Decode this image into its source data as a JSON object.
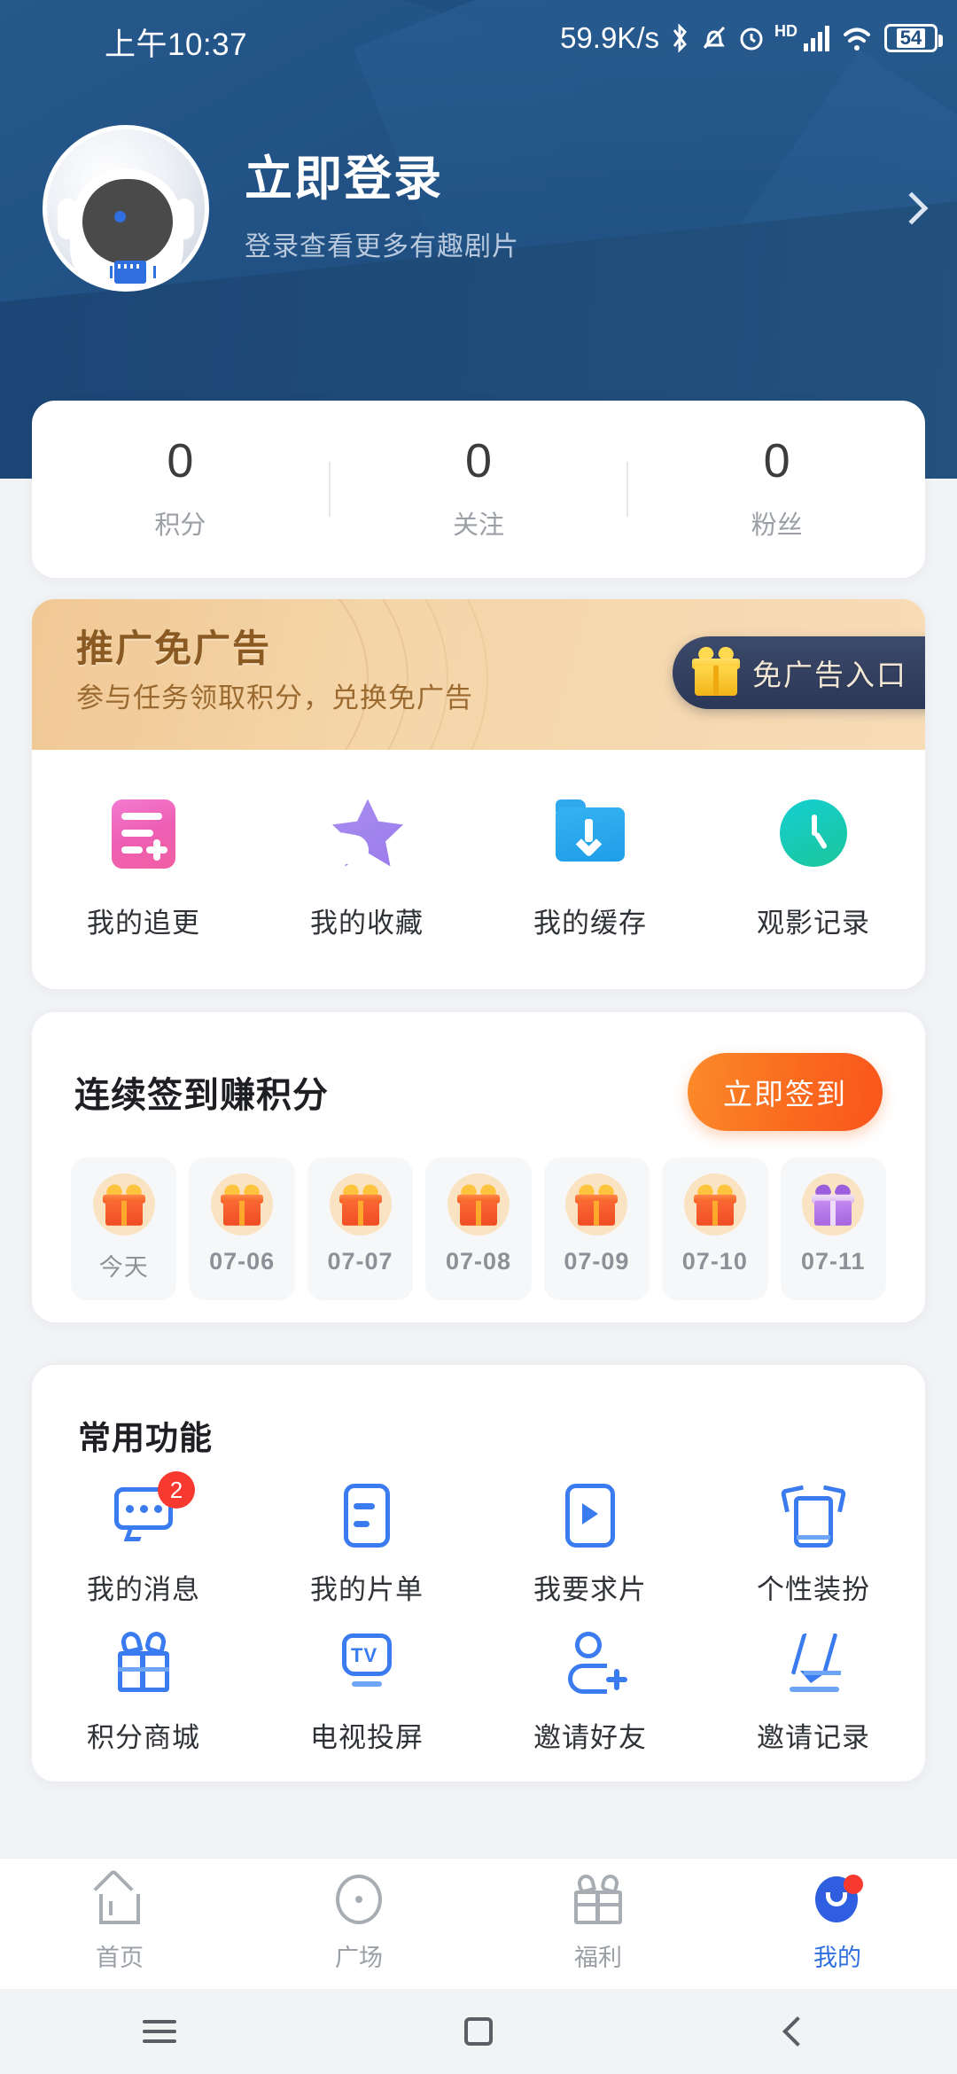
{
  "status_bar": {
    "time": "上午10:37",
    "network_speed": "59.9K/s",
    "hd_label": "HD",
    "battery": "54",
    "icons": [
      "bluetooth-icon",
      "mute-vibrate-icon",
      "alarm-icon",
      "hd-icon",
      "signal-icon",
      "wifi-icon",
      "battery-icon"
    ]
  },
  "profile": {
    "title": "立即登录",
    "subtitle": "登录查看更多有趣剧片",
    "avatar_icon": "robot-avatar",
    "arrow_icon": "chevron-right-icon"
  },
  "stats": [
    {
      "value": "0",
      "label": "积分"
    },
    {
      "value": "0",
      "label": "关注"
    },
    {
      "value": "0",
      "label": "粉丝"
    }
  ],
  "promo": {
    "title": "推广免广告",
    "subtitle": "参与任务领取积分，兑换免广告",
    "button_label": "免广告入口",
    "button_icon": "gift-icon"
  },
  "quick_actions": [
    {
      "label": "我的追更",
      "icon": "list-add-icon"
    },
    {
      "label": "我的收藏",
      "icon": "star-icon"
    },
    {
      "label": "我的缓存",
      "icon": "folder-download-icon"
    },
    {
      "label": "观影记录",
      "icon": "clock-icon"
    }
  ],
  "sign_in": {
    "title": "连续签到赚积分",
    "button_label": "立即签到",
    "days": [
      {
        "label": "今天",
        "icon": "gift-orange-icon",
        "today": true
      },
      {
        "label": "07-06",
        "icon": "gift-orange-icon",
        "today": false
      },
      {
        "label": "07-07",
        "icon": "gift-orange-icon",
        "today": false
      },
      {
        "label": "07-08",
        "icon": "gift-orange-icon",
        "today": false
      },
      {
        "label": "07-09",
        "icon": "gift-orange-icon",
        "today": false
      },
      {
        "label": "07-10",
        "icon": "gift-orange-icon",
        "today": false
      },
      {
        "label": "07-11",
        "icon": "gift-purple-icon",
        "today": false
      }
    ]
  },
  "common_functions": {
    "title": "常用功能",
    "items": [
      {
        "label": "我的消息",
        "icon": "message-icon",
        "badge": "2"
      },
      {
        "label": "我的片单",
        "icon": "playlist-icon",
        "badge": ""
      },
      {
        "label": "我要求片",
        "icon": "request-video-icon",
        "badge": ""
      },
      {
        "label": "个性装扮",
        "icon": "outfit-icon",
        "badge": ""
      },
      {
        "label": "积分商城",
        "icon": "gift-shop-icon",
        "badge": ""
      },
      {
        "label": "电视投屏",
        "icon": "tv-cast-icon",
        "badge": ""
      },
      {
        "label": "邀请好友",
        "icon": "add-friend-icon",
        "badge": ""
      },
      {
        "label": "邀请记录",
        "icon": "edit-record-icon",
        "badge": ""
      }
    ]
  },
  "bottom_nav": [
    {
      "label": "首页",
      "icon": "home-icon",
      "active": false
    },
    {
      "label": "广场",
      "icon": "discover-icon",
      "active": false
    },
    {
      "label": "福利",
      "icon": "gift-nav-icon",
      "active": false
    },
    {
      "label": "我的",
      "icon": "profile-icon",
      "active": true
    }
  ],
  "system_nav": {
    "recents": "menu-icon",
    "home": "square-icon",
    "back": "back-icon"
  },
  "colors": {
    "header_blue": "#1f4e80",
    "accent_blue": "#3a7bf0",
    "active_nav": "#2f6fe0",
    "promo_bg": "#f3d2a2",
    "sign_button": "#fa6a1e",
    "badge_red": "#f8392f",
    "page_bg": "#f2f3f5"
  }
}
